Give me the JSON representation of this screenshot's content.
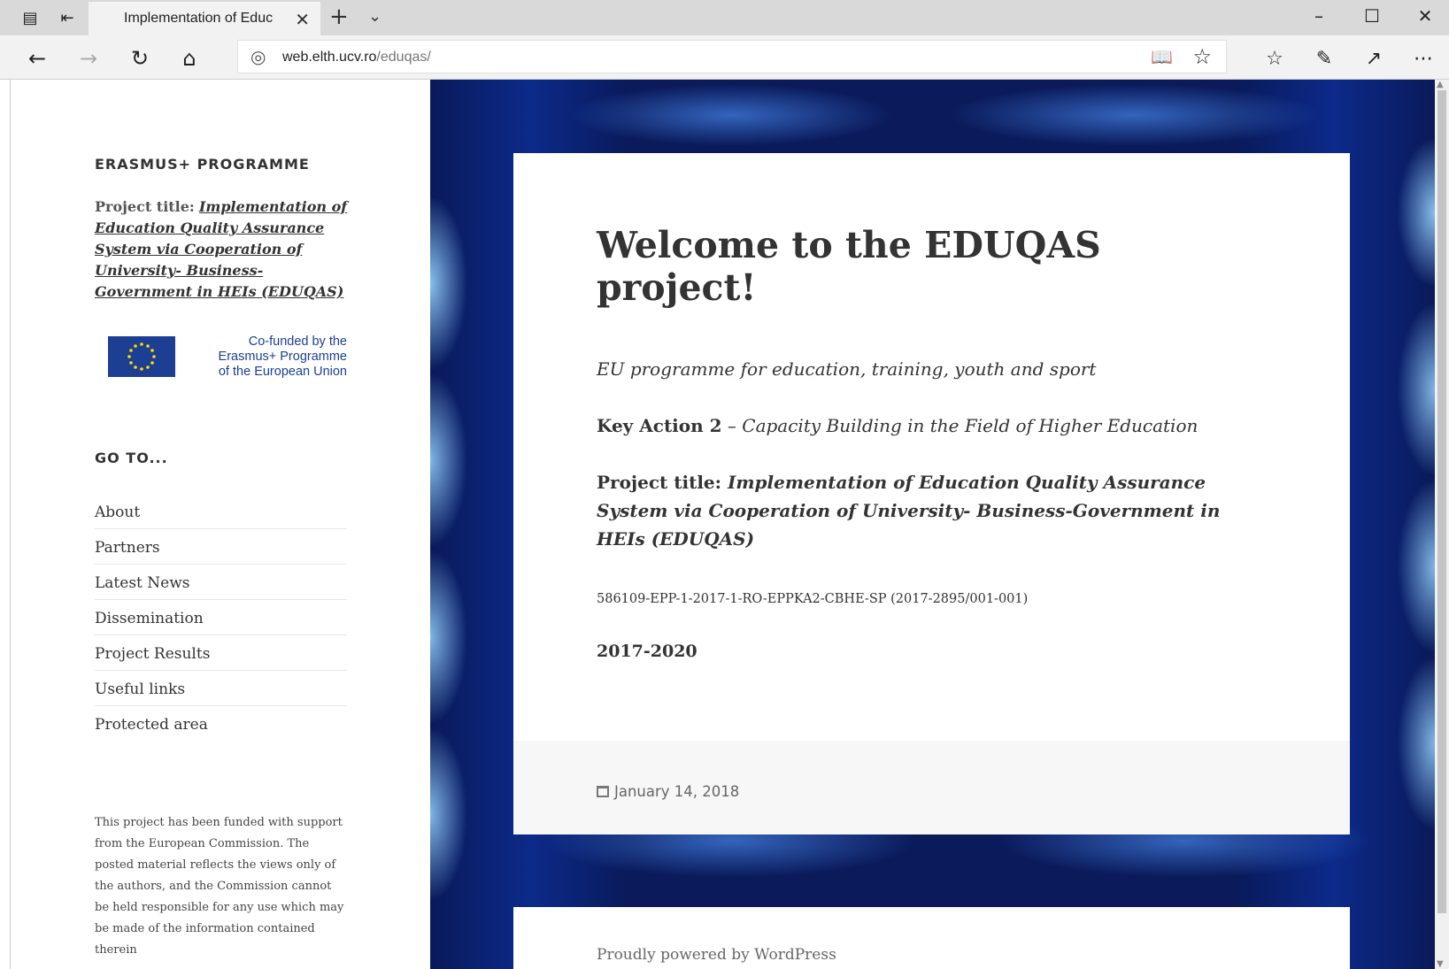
{
  "browser": {
    "tab_title": "Implementation of Educ",
    "url_host": "web.elth.ucv.ro",
    "url_path": "/eduqas/"
  },
  "sidebar": {
    "site_title": "ERASMUS+ PROGRAMME",
    "project_label": "Project title:",
    "project_link": "Implementation of Education Quality Assurance System via Cooperation of University- Business-Government in HEIs (EDUQAS)",
    "eu_logo_text": [
      "Co-funded by the",
      "Erasmus+ Programme",
      "of the European Union"
    ],
    "goto_heading": "GO TO...",
    "nav_items": [
      {
        "label": "About"
      },
      {
        "label": "Partners"
      },
      {
        "label": "Latest News"
      },
      {
        "label": "Dissemination"
      },
      {
        "label": "Project Results"
      },
      {
        "label": "Useful links"
      },
      {
        "label": "Protected area"
      }
    ],
    "disclaimer": "This project has been funded with support from the European Commission. The posted material reflects the views only of the authors, and the Commission cannot be held responsible for any use which may be made of the information contained therein"
  },
  "post": {
    "title": "Welcome to the EDUQAS project!",
    "subtitle": "EU programme for education, training, youth and sport",
    "key_action_label": "Key Action 2",
    "key_action_sep": " – ",
    "key_action_text": "Capacity Building in the Field of Higher Education",
    "project_label": "Project title: ",
    "project_title": "Implementation of Education Quality Assurance System via Cooperation of University- Business-Government in HEIs (EDUQAS)",
    "project_code": "586109-EPP-1-2017-1-RO-EPPKA2-CBHE-SP (2017-2895/001-001)",
    "years": "2017-2020",
    "date": "January 14, 2018"
  },
  "footer": {
    "powered": "Proudly powered by WordPress"
  }
}
